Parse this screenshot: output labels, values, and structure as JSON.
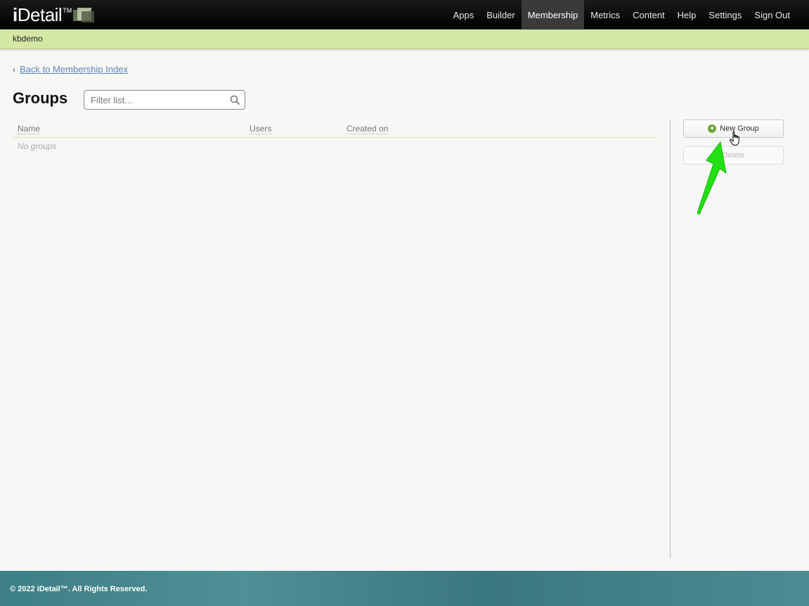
{
  "brand": {
    "name_bold": "i",
    "name_rest": "Detail",
    "tm": "TM"
  },
  "nav": {
    "items": [
      {
        "label": "Apps",
        "active": false
      },
      {
        "label": "Builder",
        "active": false
      },
      {
        "label": "Membership",
        "active": true
      },
      {
        "label": "Metrics",
        "active": false
      },
      {
        "label": "Content",
        "active": false
      },
      {
        "label": "Help",
        "active": false
      },
      {
        "label": "Settings",
        "active": false
      },
      {
        "label": "Sign Out",
        "active": false
      }
    ]
  },
  "subbar": {
    "account": "kbdemo"
  },
  "main": {
    "back_link": "Back to Membership Index",
    "title": "Groups",
    "filter": {
      "placeholder": "Filter list...",
      "value": ""
    },
    "table": {
      "columns": [
        "Name",
        "Users",
        "Created on"
      ],
      "empty_text": "No groups"
    }
  },
  "sidebar": {
    "new_button": "New Group",
    "delete_button": "Delete"
  },
  "footer": {
    "copyright": "© 2022 iDetail™.  All Rights Reserved."
  },
  "colors": {
    "accent_green": "#d4e7a4",
    "arrow_green": "#22e012",
    "link_blue": "#5f85b8",
    "footer_teal": "#3d7f86"
  }
}
